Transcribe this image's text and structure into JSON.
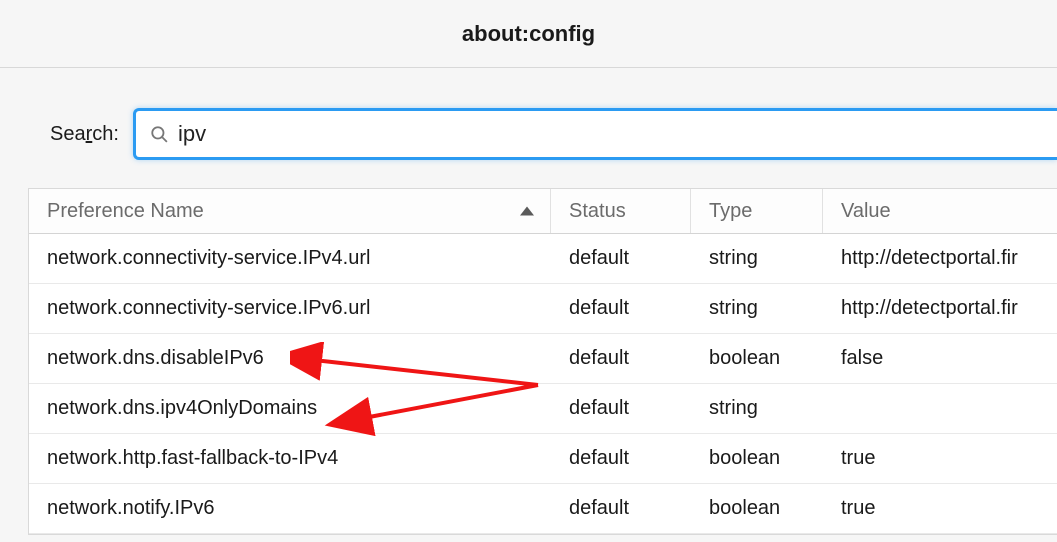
{
  "titlebar": {
    "title": "about:config"
  },
  "search": {
    "label_pre": "Sea",
    "label_underline": "r",
    "label_post": "ch:",
    "value": "ipv",
    "placeholder": ""
  },
  "table": {
    "headers": {
      "name": "Preference Name",
      "status": "Status",
      "type": "Type",
      "value": "Value",
      "sort_column": "name",
      "sort_dir": "asc"
    },
    "rows": [
      {
        "name": "network.connectivity-service.IPv4.url",
        "status": "default",
        "type": "string",
        "value": "http://detectportal.fir"
      },
      {
        "name": "network.connectivity-service.IPv6.url",
        "status": "default",
        "type": "string",
        "value": "http://detectportal.fir"
      },
      {
        "name": "network.dns.disableIPv6",
        "status": "default",
        "type": "boolean",
        "value": "false"
      },
      {
        "name": "network.dns.ipv4OnlyDomains",
        "status": "default",
        "type": "string",
        "value": ""
      },
      {
        "name": "network.http.fast-fallback-to-IPv4",
        "status": "default",
        "type": "boolean",
        "value": "true"
      },
      {
        "name": "network.notify.IPv6",
        "status": "default",
        "type": "boolean",
        "value": "true"
      }
    ]
  }
}
